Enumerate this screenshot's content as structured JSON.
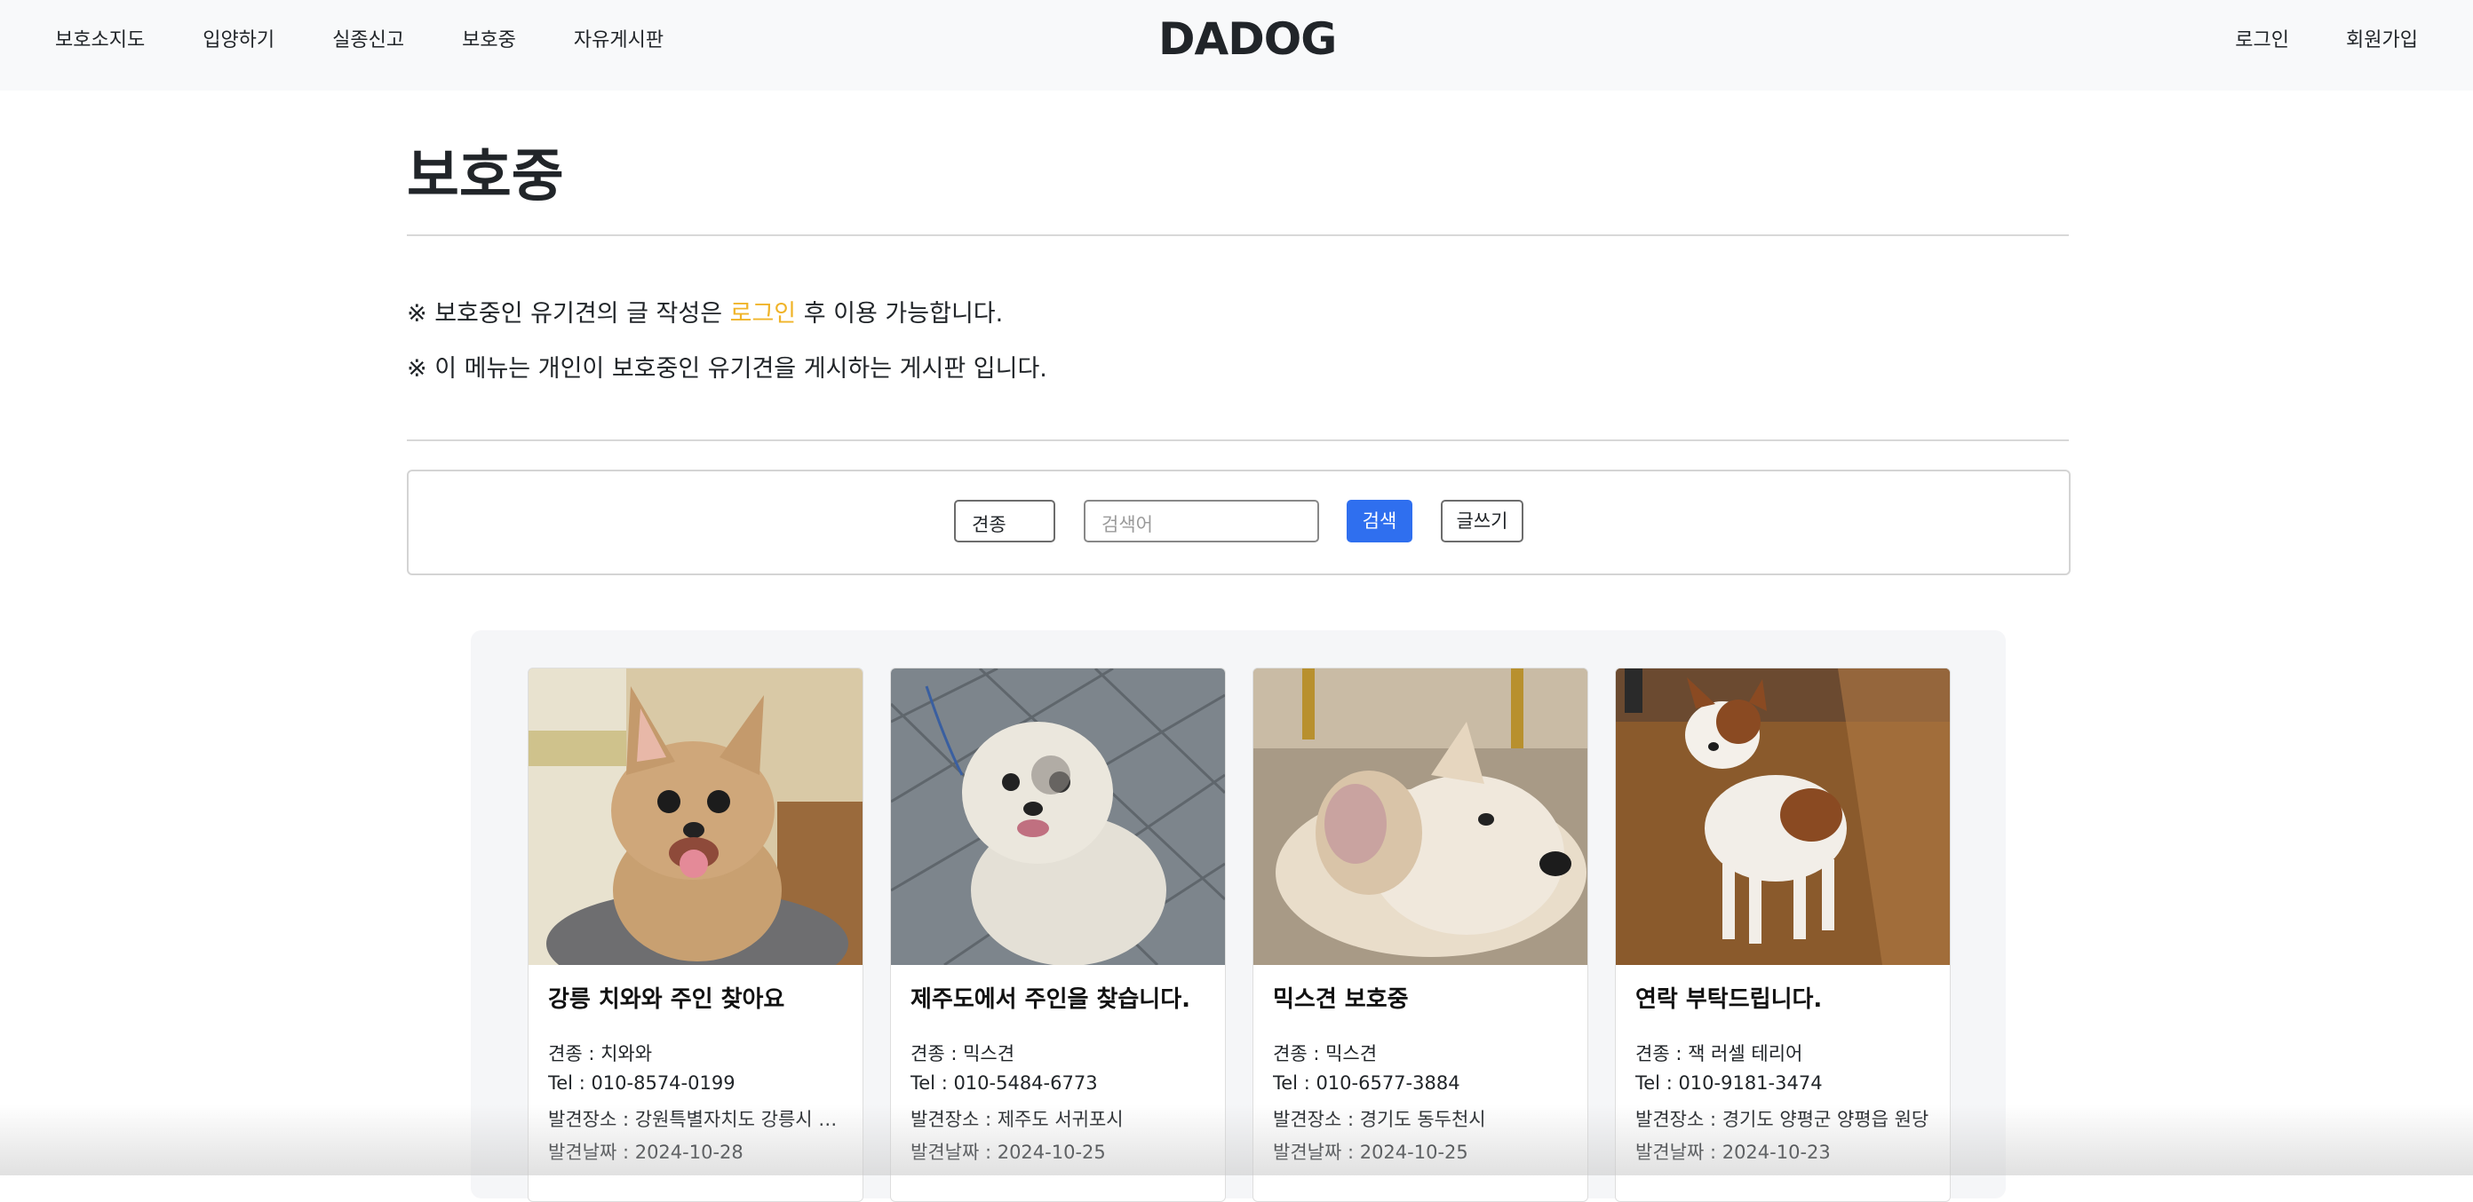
{
  "nav": {
    "brand": "DADOG",
    "left_items": [
      "보호소지도",
      "입양하기",
      "실종신고",
      "보호중",
      "자유게시판"
    ],
    "right_items": [
      "로그인",
      "회원가입"
    ]
  },
  "page": {
    "title": "보호중",
    "notice1_prefix": "※ 보호중인 유기견의 글 작성은 ",
    "notice1_link": "로그인",
    "notice1_suffix": " 후 이용 가능합니다.",
    "notice2": "※ 이 메뉴는 개인이 보호중인 유기견을 게시하는 게시판 입니다."
  },
  "search": {
    "select_value": "견종",
    "input_placeholder": "검색어",
    "search_label": "검색",
    "write_label": "글쓰기"
  },
  "cards": [
    {
      "title": "강릉 치와와 주인 찾아요",
      "breed": "견종 : 치와와",
      "tel": "Tel : 010-8574-0199",
      "place": "발견장소 : 강원특별자치도 강릉시 …",
      "date": "발견날짜 : 2024-10-28"
    },
    {
      "title": "제주도에서 주인을 찾습니다.",
      "breed": "견종 : 믹스견",
      "tel": "Tel : 010-5484-6773",
      "place": "발견장소 : 제주도 서귀포시",
      "date": "발견날짜 : 2024-10-25"
    },
    {
      "title": "믹스견 보호중",
      "breed": "견종 : 믹스견",
      "tel": "Tel : 010-6577-3884",
      "place": "발견장소 : 경기도 동두천시",
      "date": "발견날짜 : 2024-10-25"
    },
    {
      "title": "연락 부탁드립니다.",
      "breed": "견종 : 잭 러셀 테리어",
      "tel": "Tel : 010-9181-3474",
      "place": "발견장소 : 경기도 양평군 양평읍 원당",
      "date": "발견날짜 : 2024-10-23"
    }
  ],
  "colors": {
    "accent_link": "#f0b429",
    "search_button": "#2f6fef",
    "navbar_bg": "#f8f9fa"
  }
}
